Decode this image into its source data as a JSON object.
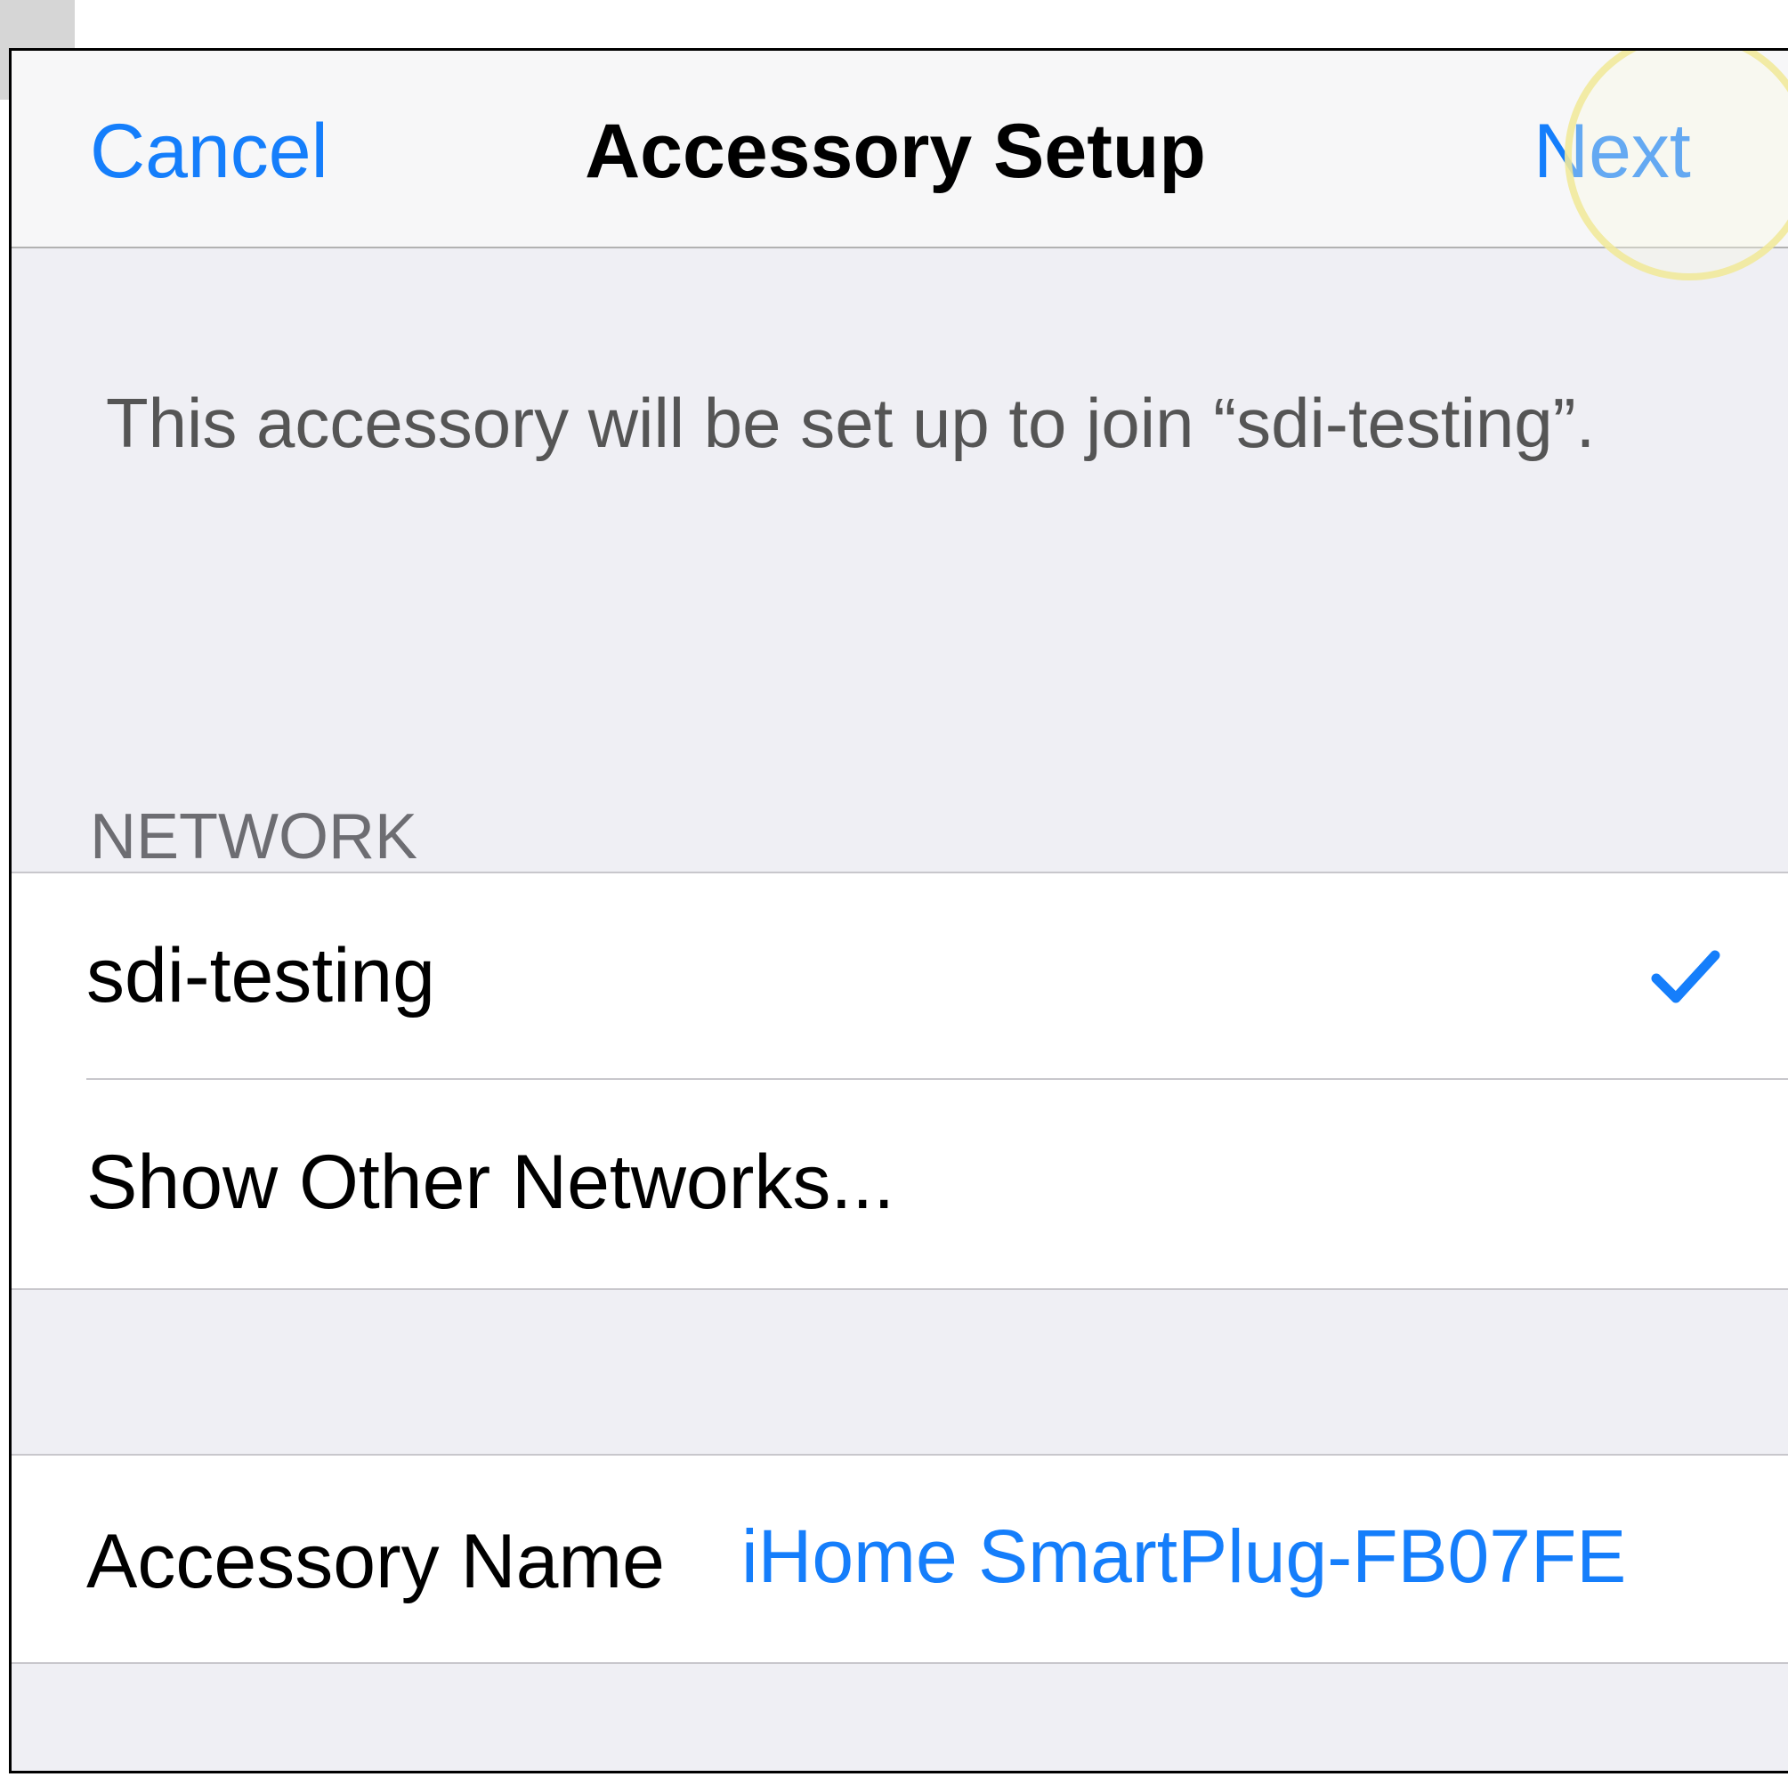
{
  "navbar": {
    "cancel_label": "Cancel",
    "title": "Accessory Setup",
    "next_label": "Next"
  },
  "info": {
    "message": "This accessory will be set up to join “sdi-testing”."
  },
  "network_section": {
    "header": "NETWORK",
    "items": [
      {
        "label": "sdi-testing",
        "selected": true
      },
      {
        "label": "Show Other Networks...",
        "selected": false
      }
    ]
  },
  "accessory": {
    "name_label": "Accessory Name",
    "name_value": "iHome SmartPlug-FB07FE"
  },
  "icons": {
    "selected_icon": "checkmark-icon"
  },
  "colors": {
    "accent": "#157efb",
    "background": "#efeff4",
    "navbar": "#f7f7f8"
  }
}
